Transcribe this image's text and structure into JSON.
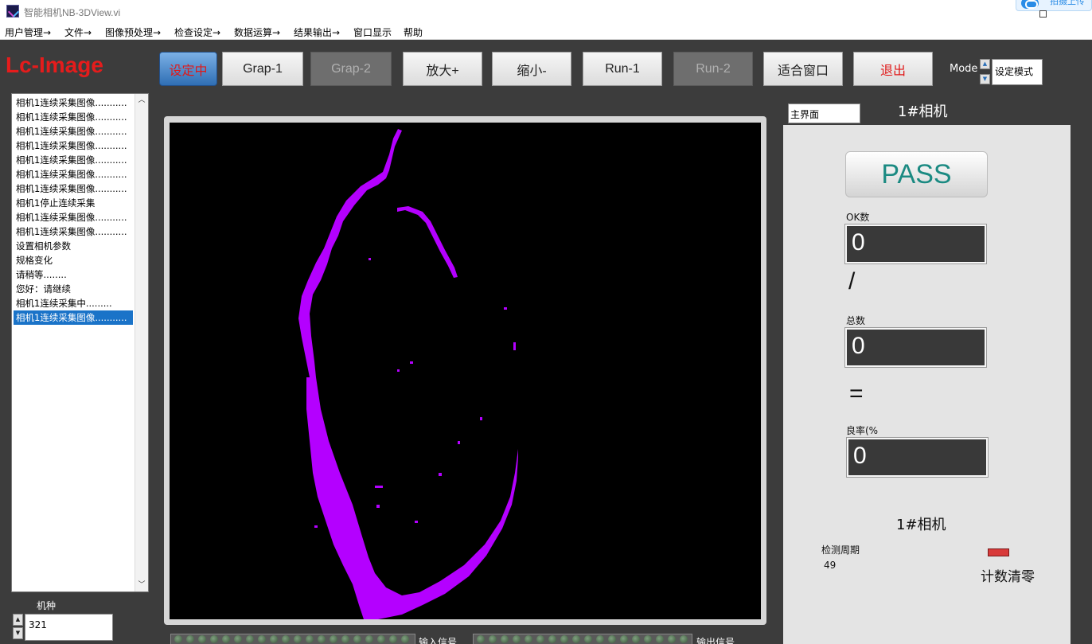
{
  "window": {
    "title": "智能相机NB-3DView.vi",
    "cloud_button": "拍摄上传"
  },
  "menu": [
    "用户管理→",
    "文件→",
    "图像预处理→",
    "检查设定→",
    "数据运算→",
    "结果输出→",
    "窗口显示",
    "帮助"
  ],
  "logo": "Lc-Image",
  "toolbar": {
    "setting": "设定中",
    "grap1": "Grap-1",
    "grap2": "Grap-2",
    "zoom_in": "放大+",
    "zoom_out": "缩小-",
    "run1": "Run-1",
    "run2": "Run-2",
    "fit": "适合窗口",
    "exit": "退出"
  },
  "mode": {
    "label": "Mode",
    "value": "设定模式"
  },
  "log": [
    "相机1连续采集图像...........",
    "相机1连续采集图像...........",
    "相机1连续采集图像...........",
    "相机1连续采集图像...........",
    "相机1连续采集图像...........",
    "相机1连续采集图像...........",
    "相机1连续采集图像...........",
    "相机1停止连续采集",
    "相机1连续采集图像...........",
    "相机1连续采集图像...........",
    "设置相机参数",
    "规格变化",
    "请稍等........",
    "您好：请继续",
    "相机1连续采集中.........",
    "相机1连续采集图像..........."
  ],
  "log_selected_index": 15,
  "model": {
    "label": "机种",
    "value": "321"
  },
  "io": {
    "input_label": "输入信号",
    "output_label": "输出信号"
  },
  "right": {
    "tab_value": "主界面",
    "camera_title": "1#相机",
    "result": "PASS",
    "ok_label": "OK数",
    "ok_value": "0",
    "divide_symbol": "/",
    "total_label": "总数",
    "total_value": "0",
    "equals_symbol": "=",
    "yield_label": "良率(%",
    "yield_value": "0",
    "camera_title_bottom": "1#相机",
    "cycle_label": "检测周期",
    "cycle_value": "49",
    "reset_label": "计数清零"
  },
  "colors": {
    "accent_red": "#e51c1c",
    "pass_teal": "#1b8a82",
    "blob_magenta": "#b400ff"
  }
}
